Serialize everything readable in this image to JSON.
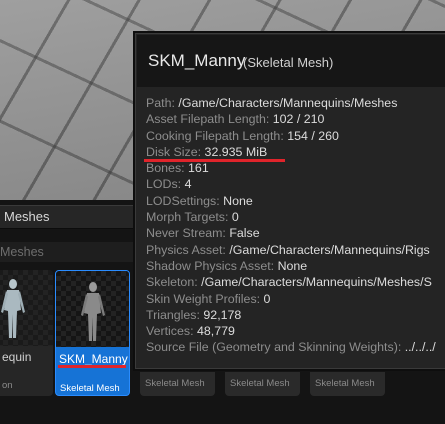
{
  "content_browser": {
    "header_label": "Meshes",
    "path_label": "Meshes",
    "left_tile": {
      "name": "equin",
      "type": "on"
    },
    "selected_tile": {
      "name": "SKM_Manny",
      "type": "Skeletal Mesh"
    },
    "stub_tiles": [
      "Skeletal Mesh",
      "Skeletal Mesh",
      "Skeletal Mesh"
    ]
  },
  "tooltip": {
    "title": "SKM_Manny",
    "type": "(Skeletal Mesh)",
    "properties": [
      {
        "key": "Path:",
        "value": "/Game/Characters/Mannequins/Meshes"
      },
      {
        "key": "Asset Filepath Length:",
        "value": "102 / 210"
      },
      {
        "key": "Cooking Filepath Length:",
        "value": "154 / 260"
      },
      {
        "key": "Disk Size:",
        "value": "32.935 MiB"
      },
      {
        "key": "Bones:",
        "value": "161"
      },
      {
        "key": "LODs:",
        "value": "4"
      },
      {
        "key": "LODSettings:",
        "value": "None"
      },
      {
        "key": "Morph Targets:",
        "value": "0"
      },
      {
        "key": "Never Stream:",
        "value": "False"
      },
      {
        "key": "Physics Asset:",
        "value": "/Game/Characters/Mannequins/Rigs"
      },
      {
        "key": "Shadow Physics Asset:",
        "value": "None"
      },
      {
        "key": "Skeleton:",
        "value": "/Game/Characters/Mannequins/Meshes/S"
      },
      {
        "key": "Skin Weight Profiles:",
        "value": "0"
      },
      {
        "key": "Triangles:",
        "value": "92,178"
      },
      {
        "key": "Vertices:",
        "value": "48,779"
      },
      {
        "key": "Source File (Geometry and Skinning Weights):",
        "value": "../../../"
      }
    ]
  },
  "colors": {
    "selection": "#1673d6",
    "highlight_underline": "#e0242b"
  }
}
